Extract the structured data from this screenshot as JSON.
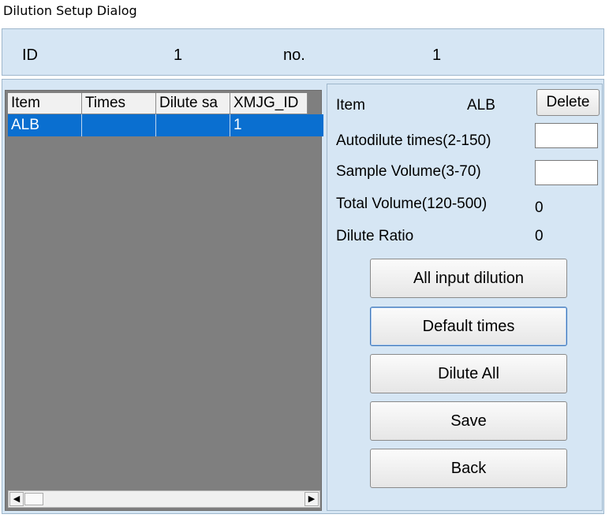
{
  "window": {
    "title": "Dilution Setup Dialog"
  },
  "header": {
    "id_label": "ID",
    "id_value": "1",
    "no_label": "no.",
    "no_value": "1"
  },
  "grid": {
    "columns": [
      "Item",
      "Times",
      "Dilute sa",
      "XMJG_ID"
    ],
    "rows": [
      {
        "item": "ALB",
        "times": "",
        "dilute": "",
        "xmjg_id": "1"
      }
    ],
    "selected_row_color": "#0a6fd0"
  },
  "form": {
    "item_label": "Item",
    "item_value": "ALB",
    "delete_label": "Delete",
    "autodilute_label": "Autodilute times(2-150)",
    "autodilute_value": "",
    "sample_volume_label": "Sample Volume(3-70)",
    "sample_volume_value": "",
    "total_volume_label": "Total Volume(120-500)",
    "total_volume_value": "0",
    "dilute_ratio_label": "Dilute Ratio",
    "dilute_ratio_value": "0"
  },
  "buttons": {
    "all_input_dilution": "All input dilution",
    "default_times": "Default times",
    "dilute_all": "Dilute All",
    "save": "Save",
    "back": "Back"
  },
  "icons": {
    "scroll_left": "arrow-left-icon",
    "scroll_right": "arrow-right-icon"
  },
  "colors": {
    "panel_bg": "#d6e6f4",
    "grid_bg": "#7f7f7f"
  }
}
